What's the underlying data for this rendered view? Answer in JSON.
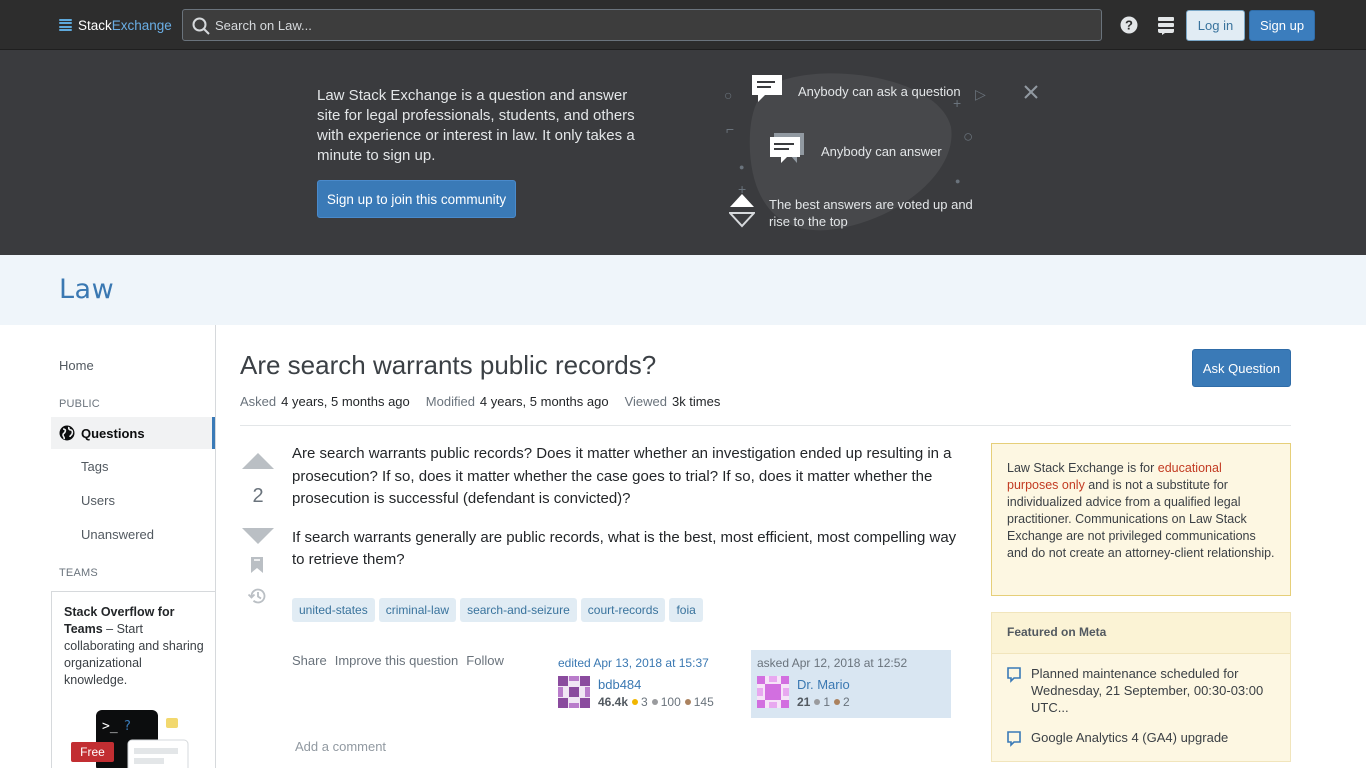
{
  "topbar": {
    "logo_stack": "Stack",
    "logo_exchange": "Exchange",
    "search_placeholder": "Search on Law...",
    "login_label": "Log in",
    "signup_label": "Sign up"
  },
  "hero": {
    "description": "Law Stack Exchange is a question and answer site for legal professionals, students, and others with experience or interest in law. It only takes a minute to sign up.",
    "cta_label": "Sign up to join this community",
    "features": [
      "Anybody can ask a question",
      "Anybody can answer",
      "The best answers are voted up and rise to the top"
    ]
  },
  "site": {
    "name": "Law"
  },
  "leftnav": {
    "home": "Home",
    "public_heading": "PUBLIC",
    "questions": "Questions",
    "tags": "Tags",
    "users": "Users",
    "unanswered": "Unanswered",
    "teams_heading": "TEAMS",
    "teams_title": "Stack Overflow for Teams",
    "teams_body": " – Start collaborating and sharing organizational knowledge.",
    "free_badge": "Free"
  },
  "question": {
    "title": "Are search warrants public records?",
    "ask_button": "Ask Question",
    "asked_label": "Asked",
    "asked_value": "4 years, 5 months ago",
    "modified_label": "Modified",
    "modified_value": "4 years, 5 months ago",
    "viewed_label": "Viewed",
    "viewed_value": "3k times",
    "votes": "2",
    "body": [
      "Are search warrants public records? Does it matter whether an investigation ended up resulting in a prosecution? If so, does it matter whether the case goes to trial? If so, does it matter whether the prosecution is successful (defendant is convicted)?",
      "If search warrants generally are public records, what is the best, most efficient, most compelling way to retrieve them?"
    ],
    "tags": [
      "united-states",
      "criminal-law",
      "search-and-seizure",
      "court-records",
      "foia"
    ],
    "menu": {
      "share": "Share",
      "improve": "Improve this question",
      "follow": "Follow"
    },
    "editor": {
      "when": "edited Apr 13, 2018 at 15:37",
      "name": "bdb484",
      "rep": "46.4k",
      "gold": "3",
      "silver": "100",
      "bronze": "145"
    },
    "asker": {
      "when": "asked Apr 12, 2018 at 12:52",
      "name": "Dr. Mario",
      "rep": "21",
      "silver": "1",
      "bronze": "2"
    },
    "add_comment": "Add a comment"
  },
  "notice": {
    "pre": "Law Stack Exchange is for ",
    "highlight": "educational purposes only",
    "post": " and is not a substitute for individualized advice from a qualified legal practitioner. Communications on Law Stack Exchange are not privileged communications and do not create an attorney-client relationship."
  },
  "featured_meta": {
    "heading": "Featured on Meta",
    "items": [
      "Planned maintenance scheduled for Wednesday, 21 September, 00:30-03:00 UTC...",
      "Google Analytics 4 (GA4) upgrade"
    ]
  },
  "colors": {
    "accent": "#3a7ab7",
    "link": "#3a78b2",
    "tag_bg": "#e1ecf4",
    "gold": "#f1b600",
    "silver": "#9a9b9e",
    "bronze": "#ab825f"
  }
}
